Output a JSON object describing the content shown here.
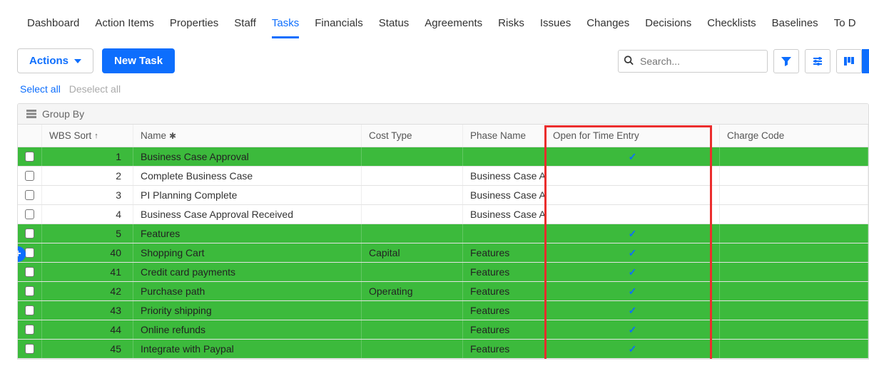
{
  "nav": {
    "tabs": [
      {
        "label": "Dashboard"
      },
      {
        "label": "Action Items"
      },
      {
        "label": "Properties"
      },
      {
        "label": "Staff"
      },
      {
        "label": "Tasks",
        "active": true
      },
      {
        "label": "Financials"
      },
      {
        "label": "Status"
      },
      {
        "label": "Agreements"
      },
      {
        "label": "Risks"
      },
      {
        "label": "Issues"
      },
      {
        "label": "Changes"
      },
      {
        "label": "Decisions"
      },
      {
        "label": "Checklists"
      },
      {
        "label": "Baselines"
      },
      {
        "label": "To D"
      }
    ]
  },
  "toolbar": {
    "actions_label": "Actions",
    "new_task_label": "New Task",
    "search_placeholder": "Search..."
  },
  "selection": {
    "select_all": "Select all",
    "deselect_all": "Deselect all"
  },
  "grid": {
    "group_by_label": "Group By",
    "columns": {
      "wbs": "WBS Sort",
      "name": "Name",
      "cost": "Cost Type",
      "phase": "Phase Name",
      "open": "Open for Time Entry",
      "charge": "Charge Code"
    },
    "rows": [
      {
        "wbs": "1",
        "name": "Business Case Approval",
        "cost": "",
        "phase": "",
        "open": true,
        "green": true
      },
      {
        "wbs": "2",
        "name": "Complete Business Case",
        "cost": "",
        "phase": "Business Case A...",
        "open": false,
        "green": false
      },
      {
        "wbs": "3",
        "name": "PI Planning Complete",
        "cost": "",
        "phase": "Business Case A...",
        "open": false,
        "green": false
      },
      {
        "wbs": "4",
        "name": "Business Case Approval Received",
        "cost": "",
        "phase": "Business Case A...",
        "open": false,
        "green": false
      },
      {
        "wbs": "5",
        "name": "Features",
        "cost": "",
        "phase": "",
        "open": true,
        "green": true
      },
      {
        "wbs": "40",
        "name": "Shopping Cart",
        "cost": "Capital",
        "phase": "Features",
        "open": true,
        "green": true
      },
      {
        "wbs": "41",
        "name": "Credit card payments",
        "cost": "",
        "phase": "Features",
        "open": true,
        "green": true
      },
      {
        "wbs": "42",
        "name": "Purchase path",
        "cost": "Operating",
        "phase": "Features",
        "open": true,
        "green": true
      },
      {
        "wbs": "43",
        "name": "Priority shipping",
        "cost": "",
        "phase": "Features",
        "open": true,
        "green": true
      },
      {
        "wbs": "44",
        "name": "Online refunds",
        "cost": "",
        "phase": "Features",
        "open": true,
        "green": true
      },
      {
        "wbs": "45",
        "name": "Integrate with Paypal",
        "cost": "",
        "phase": "Features",
        "open": true,
        "green": true
      }
    ]
  }
}
